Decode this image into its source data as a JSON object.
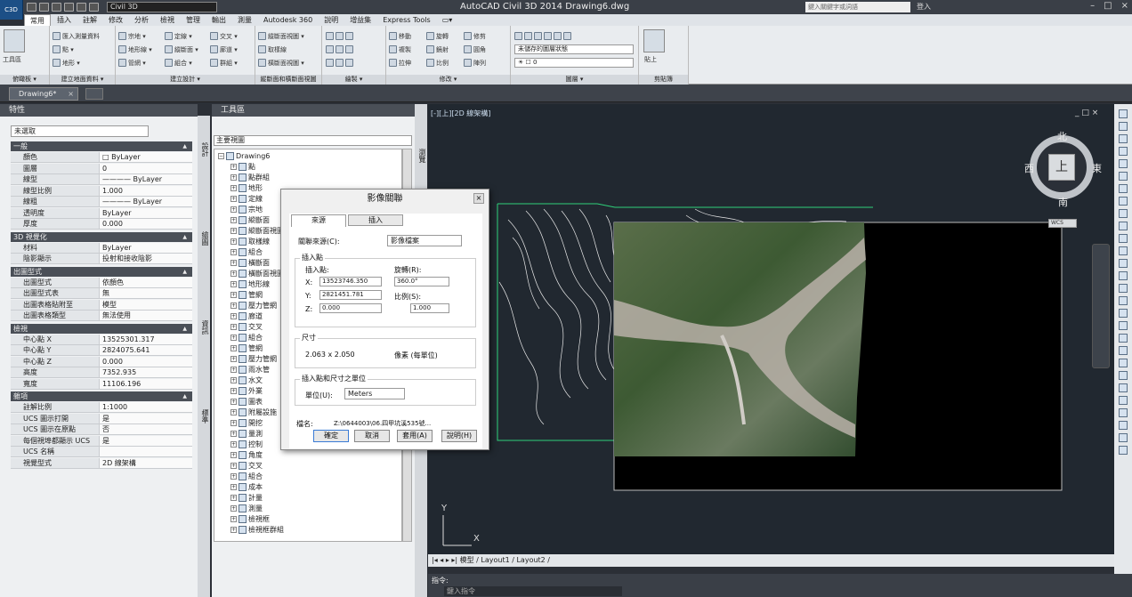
{
  "app": {
    "title": "AutoCAD Civil 3D 2014    Drawing6.dwg",
    "workspace": "Civil 3D",
    "search_placeholder": "鍵入關鍵字或詞語",
    "login": "登入",
    "app_button": "C3D"
  },
  "ribbon_tabs": [
    "常用",
    "插入",
    "註解",
    "修改",
    "分析",
    "檢視",
    "管理",
    "輸出",
    "測量",
    "Autodesk 360",
    "說明",
    "增益集",
    "Express Tools"
  ],
  "ribbon_active_tab": "常用",
  "ribbon": {
    "panels": [
      {
        "title": "俯瞰板 ▾",
        "items": [
          "工具區"
        ]
      },
      {
        "title": "建立地面資料 ▾",
        "items": [
          "匯入測量資料",
          "點 ▾",
          "地形 ▾"
        ]
      },
      {
        "title": "建立設計 ▾",
        "items": [
          "宗地 ▾",
          "地形線 ▾",
          "管網 ▾",
          "定線 ▾",
          "縱斷面 ▾",
          "組合 ▾",
          "交叉 ▾",
          "廊道 ▾",
          "群組 ▾"
        ]
      },
      {
        "title": "縱斷面和橫斷面視圖",
        "items": [
          "縱斷面視圖 ▾",
          "取樣線",
          "橫斷面視圖 ▾"
        ]
      },
      {
        "title": "繪製 ▾",
        "items": []
      },
      {
        "title": "修改 ▾",
        "items": [
          "移動",
          "旋轉",
          "修剪",
          "複製",
          "鏡射",
          "圓角",
          "拉伸",
          "比例",
          "陣列"
        ]
      },
      {
        "title": "圖層 ▾",
        "items": [
          "未儲存的圖層狀態"
        ]
      },
      {
        "title": "剪貼簿",
        "items": [
          "貼上"
        ]
      }
    ]
  },
  "doc_tab": {
    "label": "Drawing6*",
    "close": "×"
  },
  "properties": {
    "title": "特性",
    "selection": "未選取",
    "sections": [
      {
        "name": "一般",
        "rows": [
          [
            "顏色",
            "□ ByLayer"
          ],
          [
            "圖層",
            "0"
          ],
          [
            "線型",
            "———— ByLayer"
          ],
          [
            "線型比例",
            "1.000"
          ],
          [
            "線粗",
            "———— ByLayer"
          ],
          [
            "透明度",
            "ByLayer"
          ],
          [
            "厚度",
            "0.000"
          ]
        ]
      },
      {
        "name": "3D 視覺化",
        "rows": [
          [
            "材料",
            "ByLayer"
          ],
          [
            "陰影顯示",
            "投射和接收陰影"
          ]
        ]
      },
      {
        "name": "出圖型式",
        "rows": [
          [
            "出圖型式",
            "依顏色"
          ],
          [
            "出圖型式表",
            "無"
          ],
          [
            "出圖表格貼附至",
            "模型"
          ],
          [
            "出圖表格類型",
            "無法使用"
          ]
        ]
      },
      {
        "name": "檢視",
        "rows": [
          [
            "中心點 X",
            "13525301.317"
          ],
          [
            "中心點 Y",
            "2824075.641"
          ],
          [
            "中心點 Z",
            "0.000"
          ],
          [
            "高度",
            "7352.935"
          ],
          [
            "寬度",
            "11106.196"
          ]
        ]
      },
      {
        "name": "雜項",
        "rows": [
          [
            "註解比例",
            "1:1000"
          ],
          [
            "UCS 圖示打開",
            "是"
          ],
          [
            "UCS 圖示在原點",
            "否"
          ],
          [
            "每個視埠都顯示 UCS",
            "是"
          ],
          [
            "UCS 名稱",
            ""
          ],
          [
            "視覺型式",
            "2D 線架構"
          ]
        ]
      }
    ],
    "side_tabs": [
      "設計",
      "繪圖",
      "資訊",
      "標準"
    ]
  },
  "toolspace": {
    "title": "工具區",
    "view": "主要視圖",
    "root": "Drawing6",
    "items": [
      "點",
      "點群組",
      "地形",
      "定線",
      "宗地",
      "縱斷面",
      "縱斷面視圖",
      "取樣線",
      "組合",
      "橫斷面",
      "橫斷面視圖",
      "地形線",
      "管網",
      "壓力管網",
      "廊道",
      "交叉",
      "組合",
      "管網",
      "壓力管網",
      "雨水管",
      "水文",
      "外業",
      "圖表",
      "附屬設施",
      "開挖",
      "量測",
      "控制",
      "角度",
      "交叉",
      "組合",
      "成本",
      "計量",
      "測量",
      "檢視框",
      "檢視框群組"
    ],
    "side_tabs": [
      "瀏覽",
      "設定",
      "測量",
      "工具箱"
    ]
  },
  "dialog": {
    "title": "影像關聯",
    "tabs": [
      "來源",
      "插入"
    ],
    "active_tab": "來源",
    "source_label": "關聯來源(C):",
    "source_value": "影像檔案",
    "insert_group": "插入點",
    "insert_point_label": "插入點:",
    "rotation_label": "旋轉(R):",
    "x_label": "X:",
    "x_value": "13523746.350",
    "y_label": "Y:",
    "y_value": "2821451.781",
    "z_label": "Z:",
    "z_value": "0.000",
    "rotation_value": "360.0°",
    "scale_label": "比例(S):",
    "scale_value": "1.000",
    "size_group": "尺寸",
    "size_value": "2.063 x 2.050",
    "pixel_label": "像素 (每單位)",
    "units_group": "插入點和尺寸之單位",
    "units_label": "單位(U):",
    "units_value": "Meters",
    "filename_label": "檔名:",
    "filename_value": "Z:\\0644003\\06.四甲坑溪535號...",
    "buttons": [
      "確定",
      "取消",
      "套用(A)",
      "說明(H)"
    ]
  },
  "viewport": {
    "label": "[-][上][2D 線架構]",
    "controls": "_ □ ×",
    "compass": {
      "center": "上",
      "north": "北",
      "south": "南",
      "east": "東",
      "west": "西"
    },
    "wcs": "WCS",
    "ucs_x": "X",
    "ucs_y": "Y"
  },
  "layout_tabs": "|◂ ◂ ▸ ▸| 模型 / Layout1 / Layout2 /",
  "command": {
    "label": "指令:",
    "placeholder": "鍵入指令"
  }
}
